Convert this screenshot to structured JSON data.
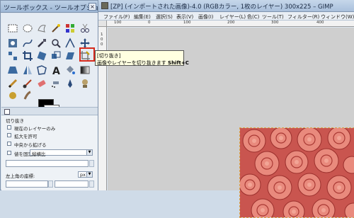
{
  "toolbox": {
    "title": "ツールボックス - ツールオプション",
    "btn_min": "_",
    "btn_max": "□",
    "btn_close": "×"
  },
  "options": {
    "tool_name": "切り抜き",
    "opt1": "現在のレイヤーのみ",
    "opt2": "拡大を許可",
    "opt3": "中央から拡げる",
    "opt4": "値を固定",
    "opt4_value": "縦横比",
    "position_label": "左上角の座標:",
    "unit": "px"
  },
  "image_window": {
    "title": "[ZP] (インポートされた画像)-4.0 (RGBカラー, 1枚のレイヤー) 300x225 – GIMP",
    "menus": [
      "ファイル(F)",
      "編集(E)",
      "選択(S)",
      "表示(V)",
      "画像(I)",
      "レイヤー(L)",
      "色(C)",
      "ツール(T)",
      "フィルター(R)",
      "ウィンドウ(W)"
    ]
  },
  "ruler": {
    "top_labels": [
      "100",
      "0",
      "100",
      "200",
      "300",
      "400"
    ],
    "left_labels": [
      "1",
      "0",
      "0"
    ]
  },
  "tooltip": {
    "title": "[切り抜き]",
    "desc": "画像やレイヤーを切り抜きます",
    "shortcut": "Shift+C"
  },
  "colors": {
    "selection_highlight": "#d62a1c",
    "tooltip_bg": "#ffffe1",
    "foreground": "#000000",
    "background": "#ffffff"
  }
}
